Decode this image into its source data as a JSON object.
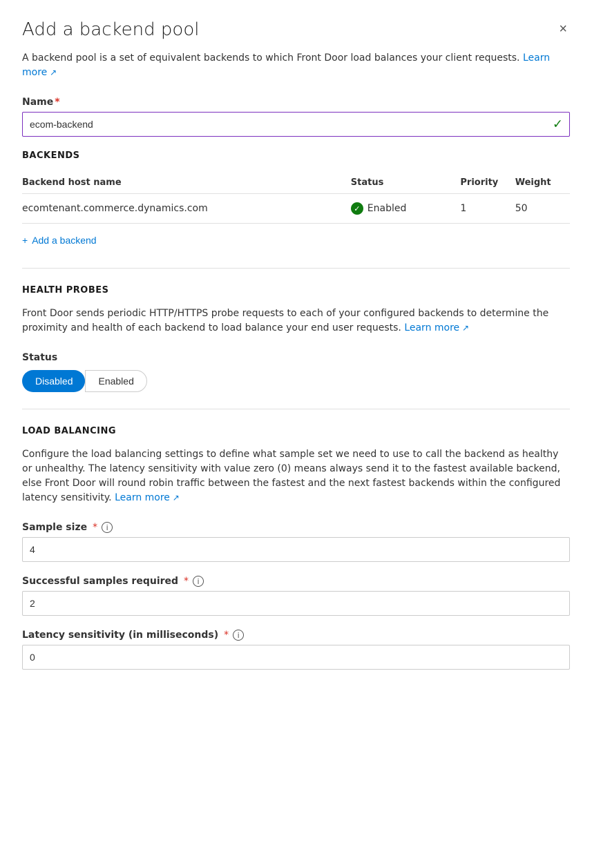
{
  "panel": {
    "title": "Add a backend pool",
    "close_label": "×",
    "description": "A backend pool is a set of equivalent backends to which Front Door load balances your client requests.",
    "learn_more_link": "Learn more",
    "name_label": "Name",
    "name_value": "ecom-backend",
    "name_placeholder": ""
  },
  "backends": {
    "section_heading": "BACKENDS",
    "columns": {
      "hostname": "Backend host name",
      "status": "Status",
      "priority": "Priority",
      "weight": "Weight"
    },
    "rows": [
      {
        "hostname": "ecomtenant.commerce.dynamics.com",
        "status": "Enabled",
        "priority": "1",
        "weight": "50"
      }
    ],
    "add_button": "Add a backend"
  },
  "health_probes": {
    "section_heading": "HEALTH PROBES",
    "description": "Front Door sends periodic HTTP/HTTPS probe requests to each of your configured backends to determine the proximity and health of each backend to load balance your end user requests.",
    "learn_more_link": "Learn more",
    "status_label": "Status",
    "toggle_options": [
      "Disabled",
      "Enabled"
    ],
    "selected_toggle": "Disabled"
  },
  "load_balancing": {
    "section_heading": "LOAD BALANCING",
    "description": "Configure the load balancing settings to define what sample set we need to use to call the backend as healthy or unhealthy. The latency sensitivity with value zero (0) means always send it to the fastest available backend, else Front Door will round robin traffic between the fastest and the next fastest backends within the configured latency sensitivity.",
    "learn_more_link": "Learn more",
    "sample_size_label": "Sample size",
    "sample_size_value": "4",
    "successful_samples_label": "Successful samples required",
    "successful_samples_value": "2",
    "latency_label": "Latency sensitivity (in milliseconds)",
    "latency_value": "0"
  }
}
